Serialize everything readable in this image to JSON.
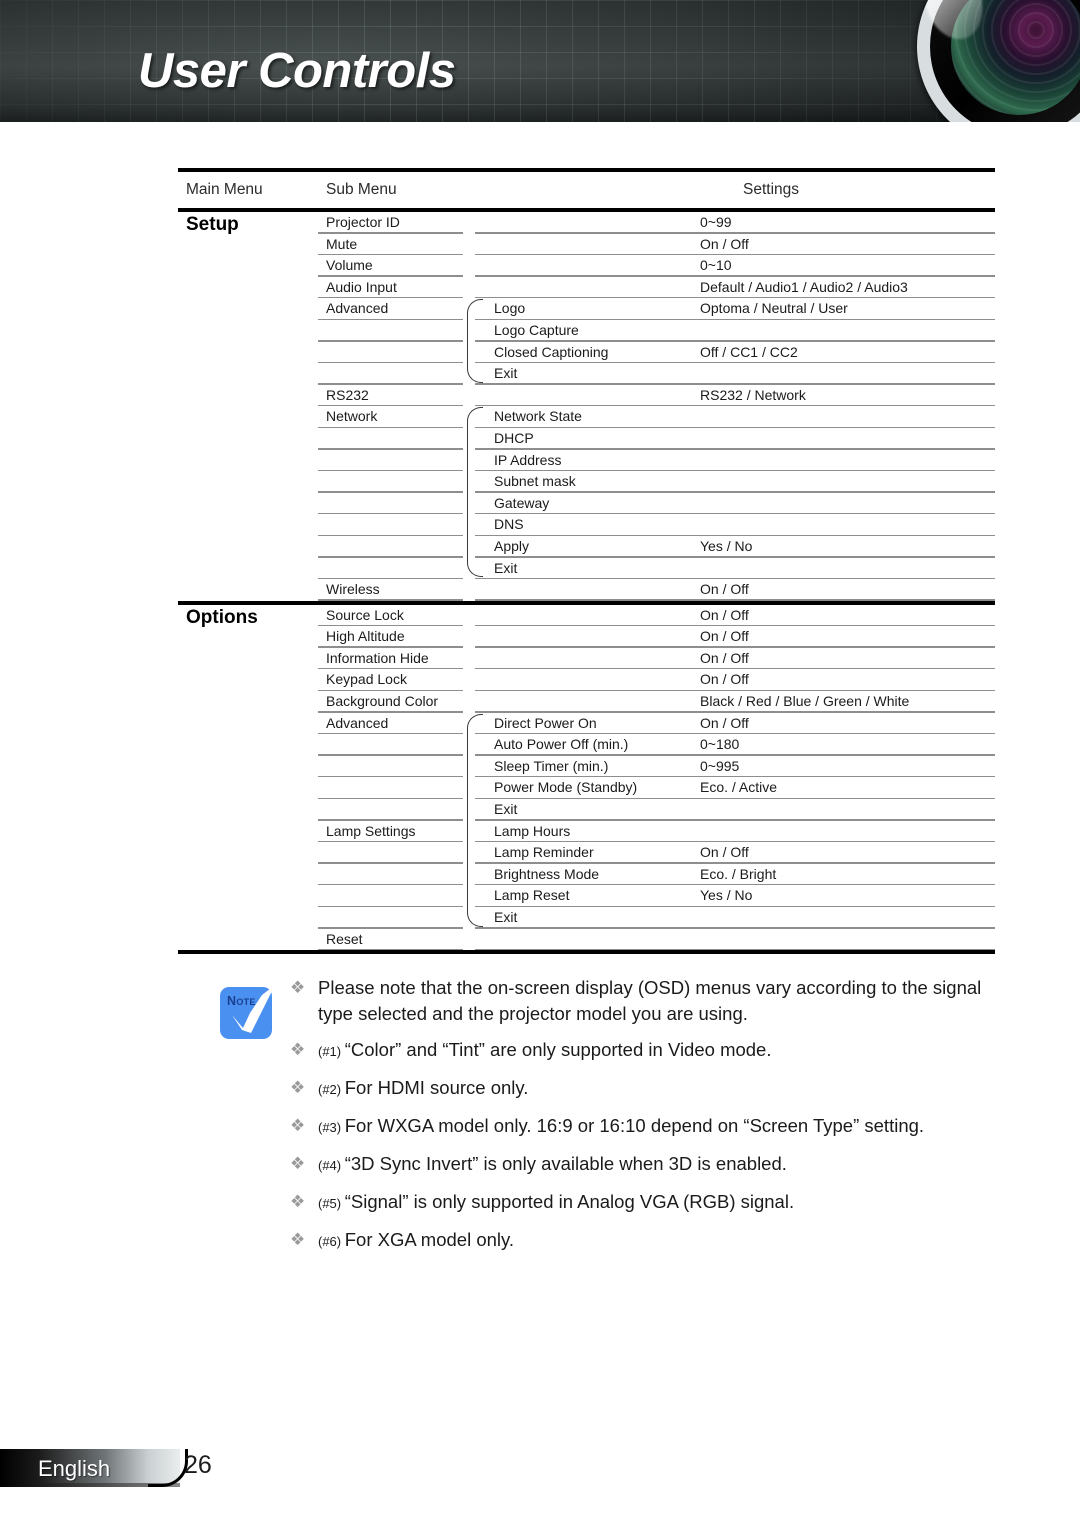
{
  "header": {
    "title": "User Controls",
    "lens_icon": "camera-lens-graphic"
  },
  "table": {
    "columns": {
      "main": "Main Menu",
      "sub": "Sub Menu",
      "settings": "Settings"
    },
    "sections": [
      {
        "name": "Setup",
        "rows": [
          {
            "sub": "Projector ID",
            "sub2": "",
            "value": "0~99"
          },
          {
            "sub": "Mute",
            "sub2": "",
            "value": "On / Off"
          },
          {
            "sub": "Volume",
            "sub2": "",
            "value": "0~10"
          },
          {
            "sub": "Audio Input",
            "sub2": "",
            "value": "Default / Audio1 / Audio2 / Audio3"
          },
          {
            "sub": "Advanced",
            "sub2": "Logo",
            "value": "Optoma / Neutral / User"
          },
          {
            "sub": "",
            "sub2": "Logo Capture",
            "value": ""
          },
          {
            "sub": "",
            "sub2": "Closed Captioning",
            "value": "Off / CC1 / CC2"
          },
          {
            "sub": "",
            "sub2": "Exit",
            "value": ""
          },
          {
            "sub": "RS232",
            "sub2": "",
            "value": "RS232 / Network"
          },
          {
            "sub": "Network",
            "sub2": "Network State",
            "value": ""
          },
          {
            "sub": "",
            "sub2": "DHCP",
            "value": ""
          },
          {
            "sub": "",
            "sub2": "IP Address",
            "value": ""
          },
          {
            "sub": "",
            "sub2": "Subnet mask",
            "value": ""
          },
          {
            "sub": "",
            "sub2": "Gateway",
            "value": ""
          },
          {
            "sub": "",
            "sub2": "DNS",
            "value": ""
          },
          {
            "sub": "",
            "sub2": "Apply",
            "value": "Yes / No"
          },
          {
            "sub": "",
            "sub2": "Exit",
            "value": ""
          },
          {
            "sub": "Wireless",
            "sub2": "",
            "value": "On / Off"
          }
        ]
      },
      {
        "name": "Options",
        "rows": [
          {
            "sub": "Source Lock",
            "sub2": "",
            "value": "On / Off"
          },
          {
            "sub": "High Altitude",
            "sub2": "",
            "value": "On / Off"
          },
          {
            "sub": "Information Hide",
            "sub2": "",
            "value": "On / Off"
          },
          {
            "sub": "Keypad Lock",
            "sub2": "",
            "value": "On / Off"
          },
          {
            "sub": "Background Color",
            "sub2": "",
            "value": "Black / Red / Blue / Green / White"
          },
          {
            "sub": "Advanced",
            "sub2": "Direct Power On",
            "value": "On / Off"
          },
          {
            "sub": "",
            "sub2": "Auto Power Off (min.)",
            "value": "0~180"
          },
          {
            "sub": "",
            "sub2": "Sleep Timer (min.)",
            "value": "0~995"
          },
          {
            "sub": "",
            "sub2": "Power Mode (Standby)",
            "value": "Eco. / Active"
          },
          {
            "sub": "",
            "sub2": "Exit",
            "value": ""
          },
          {
            "sub": "Lamp Settings",
            "sub2": "Lamp Hours",
            "value": ""
          },
          {
            "sub": "",
            "sub2": "Lamp Reminder",
            "value": "On / Off"
          },
          {
            "sub": "",
            "sub2": "Brightness Mode",
            "value": "Eco. / Bright"
          },
          {
            "sub": "",
            "sub2": "Lamp Reset",
            "value": "Yes / No"
          },
          {
            "sub": "",
            "sub2": "Exit",
            "value": ""
          },
          {
            "sub": "Reset",
            "sub2": "",
            "value": ""
          }
        ]
      }
    ]
  },
  "note": {
    "icon_label": "Note",
    "bullet_glyph": "❖",
    "items": [
      {
        "ref": "",
        "text": "Please note that the on-screen display (OSD) menus vary according to the signal type selected and the projector model you are using."
      },
      {
        "ref": "(#1)",
        "text": "“Color” and “Tint” are only supported in Video mode."
      },
      {
        "ref": "(#2)",
        "text": "For HDMI source only."
      },
      {
        "ref": "(#3)",
        "text": "For WXGA model only. 16:9 or 16:10 depend on “Screen Type” setting."
      },
      {
        "ref": "(#4)",
        "text": "“3D Sync Invert” is only available when 3D is enabled."
      },
      {
        "ref": "(#5)",
        "text": "“Signal” is only supported in Analog VGA (RGB) signal."
      },
      {
        "ref": "(#6)",
        "text": "For XGA model only."
      }
    ]
  },
  "footer": {
    "language": "English",
    "page_number": "26"
  }
}
